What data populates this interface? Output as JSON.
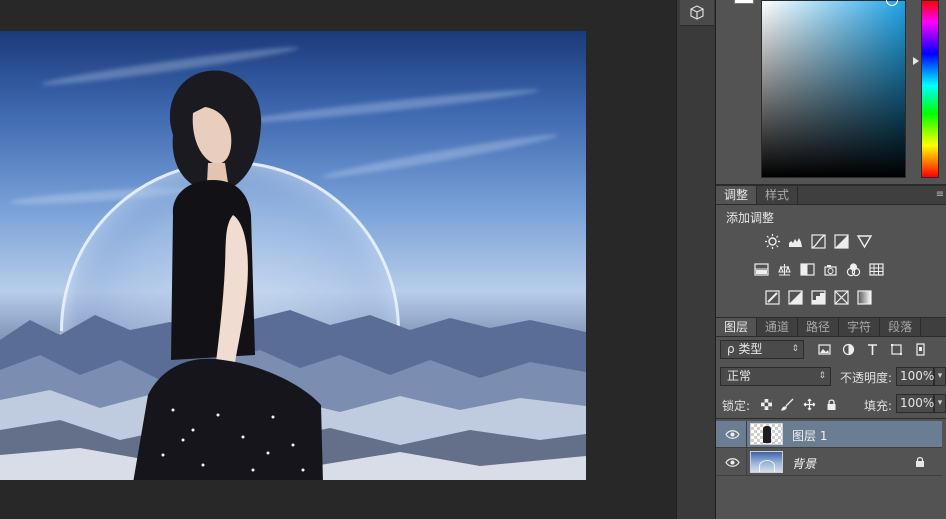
{
  "adjustments_panel": {
    "tabs": [
      {
        "label": "调整",
        "active": true
      },
      {
        "label": "样式",
        "active": false
      }
    ],
    "title": "添加调整",
    "rows": [
      [
        "brightness-contrast-icon",
        "levels-icon",
        "curves-icon",
        "exposure-icon",
        "gradient-triangle-icon"
      ],
      [
        "vibrance-icon",
        "hue-saturation-icon",
        "color-balance-icon",
        "black-white-icon",
        "photo-filter-icon",
        "channel-mixer-icon",
        "color-lookup-icon"
      ],
      [
        "invert-icon",
        "posterize-icon",
        "threshold-icon",
        "selective-color-icon",
        "gradient-map-icon"
      ]
    ]
  },
  "layers_panel": {
    "tabs": [
      {
        "label": "图层",
        "active": true
      },
      {
        "label": "通道",
        "active": false
      },
      {
        "label": "路径",
        "active": false
      },
      {
        "label": "字符",
        "active": false
      },
      {
        "label": "段落",
        "active": false
      }
    ],
    "filter_kind": "ρ 类型",
    "filter_icons": [
      "image-filter-icon",
      "adjustment-filter-icon",
      "type-filter-icon",
      "shape-filter-icon",
      "smart-object-filter-icon"
    ],
    "blend_mode": "正常",
    "opacity_label": "不透明度:",
    "opacity_value": "100%",
    "lock_label": "锁定:",
    "lock_icons": [
      "lock-transparent-icon",
      "lock-pixels-icon",
      "lock-position-icon",
      "lock-all-icon"
    ],
    "fill_label": "填充:",
    "fill_value": "100%",
    "layers": [
      {
        "name": "图层 1",
        "visible": true,
        "selected": true,
        "locked": false
      },
      {
        "name": "背景",
        "visible": true,
        "selected": false,
        "locked": true
      }
    ]
  },
  "colors": {
    "panel_bg": "#535353",
    "tab_bar_bg": "#3f3f3f",
    "selected_layer_bg": "#6b7d93",
    "app_bg": "#282828",
    "foreground_color": "#ffffff"
  },
  "icons": {
    "strip_button": "3d-cube-icon",
    "canvas_subject": "woman-on-planet-landscape-photo"
  }
}
